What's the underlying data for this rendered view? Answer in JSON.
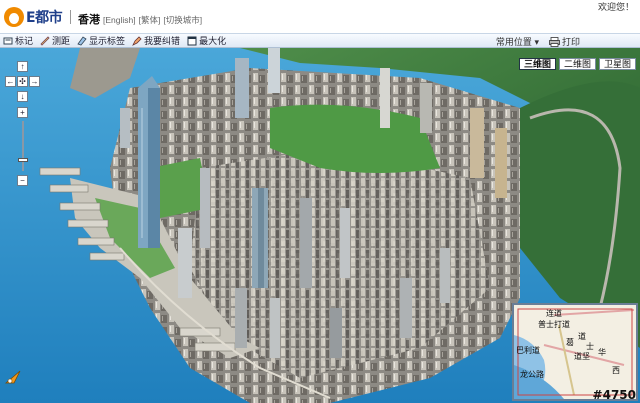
{
  "header": {
    "welcome": "欢迎您！",
    "logo_text": "E都市",
    "city_name": "香港",
    "links": [
      "[English]",
      "[繁体]",
      "[切换城市]"
    ]
  },
  "toolbar": {
    "items": [
      {
        "label": "标记",
        "icon": "tag-icon"
      },
      {
        "label": "测距",
        "icon": "ruler-icon"
      },
      {
        "label": "显示标签",
        "icon": "label-icon"
      },
      {
        "label": "我要纠错",
        "icon": "correction-icon"
      },
      {
        "label": "最大化",
        "icon": "maximize-icon"
      }
    ],
    "common_location": "常用位置",
    "print": "打印"
  },
  "map": {
    "view_tabs": [
      "三维图",
      "二维图",
      "卫星图"
    ],
    "active_tab": "三维图",
    "nav_buttons": {
      "up": "↑",
      "down": "↓",
      "left": "←",
      "right": "→",
      "zoom_in": "+",
      "zoom_out": "−"
    },
    "minimap_labels": [
      "普士打道",
      "连道",
      "巴利道",
      "龙公路",
      "道",
      "华",
      "西",
      "道坚",
      "士",
      "葛"
    ],
    "watermark": "#4750",
    "colors": {
      "sea": "#2f95cf",
      "hill": "#2f6c35",
      "toolbar": "#dfe9f5",
      "logo": "#f08a00"
    }
  }
}
